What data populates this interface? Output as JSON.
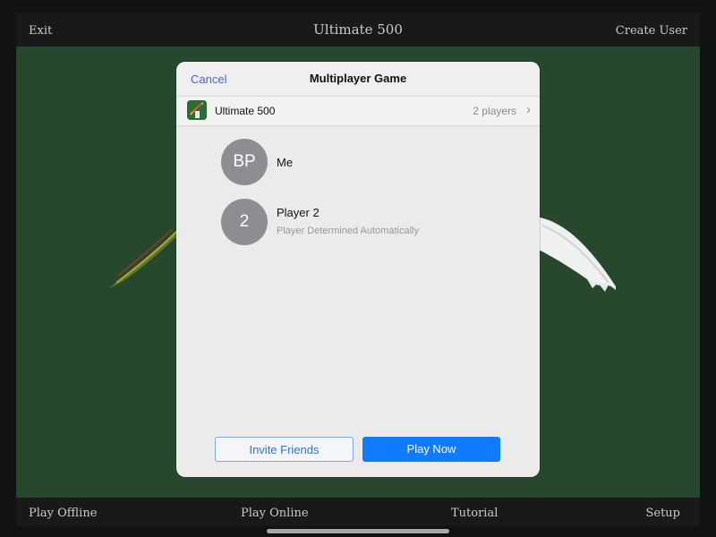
{
  "top_bar": {
    "exit_label": "Exit",
    "title": "Ultimate 500",
    "create_user_label": "Create User"
  },
  "bottom_bar": {
    "items": [
      "Play Offline",
      "Play Online",
      "Tutorial",
      "Setup"
    ]
  },
  "modal": {
    "cancel_label": "Cancel",
    "title": "Multiplayer Game",
    "game_name": "Ultimate 500",
    "player_count": "2 players",
    "players": [
      {
        "avatar_text": "BP",
        "name": "Me",
        "subtitle": ""
      },
      {
        "avatar_text": "2",
        "name": "Player 2",
        "subtitle": "Player Determined Automatically"
      }
    ],
    "invite_label": "Invite Friends",
    "play_label": "Play Now"
  },
  "colors": {
    "felt": "#28482e",
    "accent": "#117aff",
    "link": "#5064c8"
  }
}
